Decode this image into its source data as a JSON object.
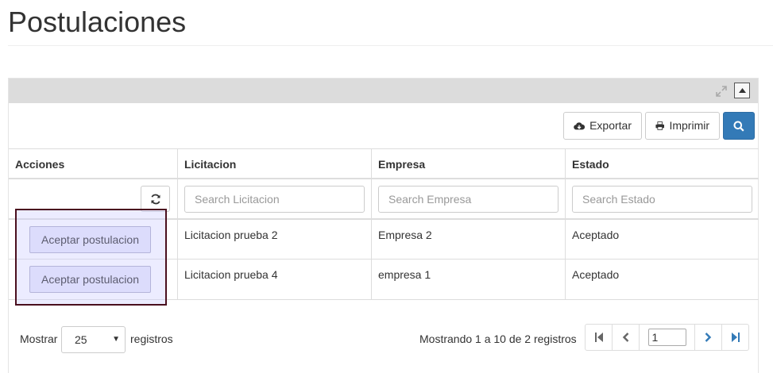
{
  "page": {
    "title": "Postulaciones"
  },
  "toolbar": {
    "export_label": "Exportar",
    "print_label": "Imprimir",
    "accent_color": "#337ab7"
  },
  "table": {
    "headers": [
      "Acciones",
      "Licitacion",
      "Empresa",
      "Estado"
    ],
    "filters": {
      "licitacion_placeholder": "Search Licitacion",
      "empresa_placeholder": "Search Empresa",
      "estado_placeholder": "Search Estado"
    },
    "rows": [
      {
        "action_label": "Aceptar postulacion",
        "licitacion": "Licitacion prueba 2",
        "empresa": "Empresa 2",
        "estado": "Aceptado"
      },
      {
        "action_label": "Aceptar postulacion",
        "licitacion": "Licitacion prueba 4",
        "empresa": "empresa 1",
        "estado": "Aceptado"
      }
    ]
  },
  "footer": {
    "show_label": "Mostrar",
    "page_size": "25",
    "records_label": "registros",
    "summary": "Mostrando 1 a 10 de 2 registros",
    "current_page": "1"
  },
  "icons": [
    "expand-icon",
    "collapse-icon",
    "cloud-download-icon",
    "print-icon",
    "search-icon",
    "refresh-icon",
    "first-page-icon",
    "prev-page-icon",
    "next-page-icon",
    "last-page-icon"
  ]
}
